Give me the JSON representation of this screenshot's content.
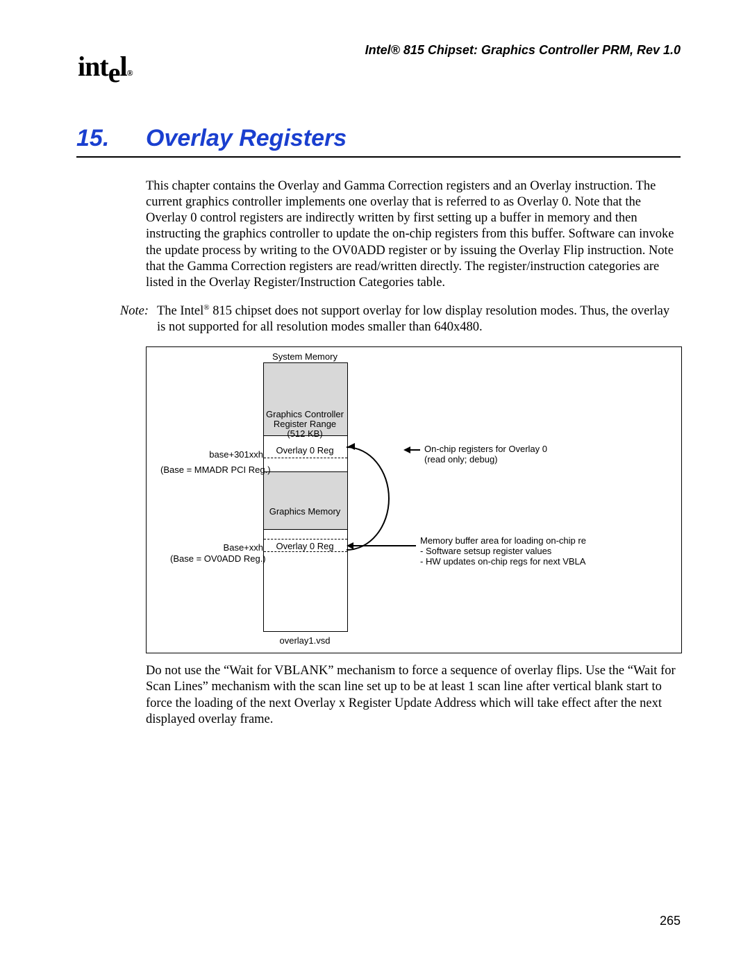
{
  "header": {
    "running": "Intel® 815 Chipset: Graphics Controller PRM, Rev 1.0",
    "logo": "intel"
  },
  "chapter": {
    "number": "15.",
    "title": "Overlay Registers"
  },
  "paragraphs": {
    "intro": "This chapter contains the Overlay and Gamma Correction registers and an Overlay instruction. The current graphics controller implements one overlay that is referred to as Overlay 0. Note that the Overlay 0 control registers are indirectly written by first setting up a buffer in memory and then instructing the graphics controller to update the on-chip registers from this buffer. Software can invoke the update process by writing to the OV0ADD register or by issuing the Overlay Flip instruction. Note that the Gamma Correction registers are read/written directly. The register/instruction categories are listed in the Overlay Register/Instruction Categories table.",
    "note_label": "Note:",
    "note_body_pre": "The Intel",
    "note_body_post": " 815 chipset does not support overlay for low display resolution modes. Thus, the overlay is not supported for all resolution modes smaller than 640x480.",
    "closing": "Do not use the “Wait for VBLANK” mechanism to force a sequence of overlay flips. Use the “Wait for Scan Lines” mechanism with the scan line set up to be at least 1 scan line after vertical blank start to force the loading of the next Overlay x Register Update Address which will take effect after the next displayed overlay frame."
  },
  "figure": {
    "system_memory": "System Memory",
    "gc_range1": "Graphics Controller",
    "gc_range2": "Register Range",
    "gc_range3": "(512 KB)",
    "overlay0_reg": "Overlay 0 Reg",
    "base_301": "base+301xxh",
    "base_mmadr": "(Base = MMADR PCI Reg.)",
    "graphics_memory": "Graphics Memory",
    "base_xx": "Base+xxh",
    "base_ov0add": "(Base = OV0ADD Reg.)",
    "filename": "overlay1.vsd",
    "right1a": "On-chip registers for Overlay 0",
    "right1b": "(read only; debug)",
    "right2a": "Memory buffer area for loading on-chip  re",
    "right2b": "- Software setsup register values",
    "right2c": "- HW updates on-chip regs for next VBLA"
  },
  "page_number": "265"
}
